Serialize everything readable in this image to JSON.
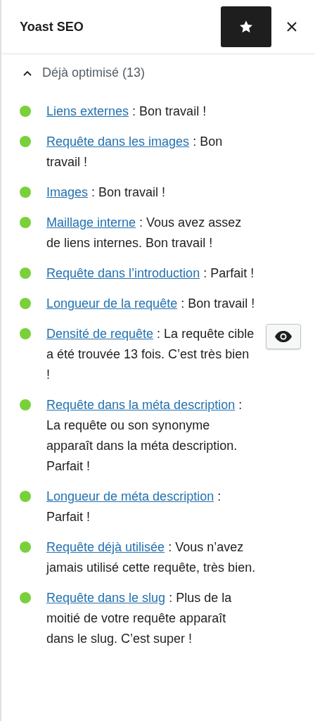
{
  "header": {
    "title": "Yoast SEO",
    "star_button": {
      "selected": true
    }
  },
  "section": {
    "title": "Déjà optimisé (13)",
    "expanded": true
  },
  "items": [
    {
      "link": "Liens externes",
      "text": " : Bon travail !",
      "color": "#7ad03a",
      "eye_button": false
    },
    {
      "link": "Requête dans les images",
      "text": " : Bon travail !",
      "color": "#7ad03a",
      "eye_button": false
    },
    {
      "link": "Images",
      "text": " : Bon travail !",
      "color": "#7ad03a",
      "eye_button": false
    },
    {
      "link": "Maillage interne",
      "text": " : Vous avez assez de liens internes. Bon travail !",
      "color": "#7ad03a",
      "eye_button": false
    },
    {
      "link": "Requête dans l’introduction",
      "text": " : Parfait !",
      "color": "#7ad03a",
      "eye_button": false
    },
    {
      "link": "Longueur de la requête",
      "text": " : Bon travail !",
      "color": "#7ad03a",
      "eye_button": false
    },
    {
      "link": "Densité de requête",
      "text": " : La requête cible a été trouvée 13 fois. C’est très bien !",
      "color": "#7ad03a",
      "eye_button": true
    },
    {
      "link": "Requête dans la méta description",
      "text": " : La requête ou son synonyme apparaît dans la méta description. Parfait !",
      "color": "#7ad03a",
      "eye_button": false
    },
    {
      "link": "Longueur de méta description",
      "text": " : Parfait !",
      "color": "#7ad03a",
      "eye_button": false
    },
    {
      "link": "Requête déjà utilisée",
      "text": " : Vous n’avez jamais utilisé cette requête, très bien.",
      "color": "#7ad03a",
      "eye_button": false
    },
    {
      "link": "Requête dans le slug",
      "text": " : Plus de la moitié de votre requête apparaît dans le slug. C’est super !",
      "color": "#7ad03a",
      "eye_button": false
    }
  ]
}
